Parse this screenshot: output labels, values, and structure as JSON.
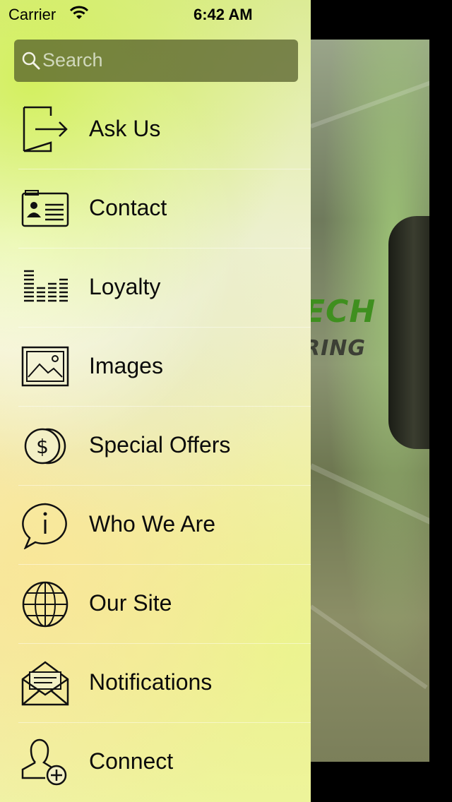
{
  "status_bar": {
    "carrier": "Carrier",
    "time": "6:42 AM",
    "wifi_icon": "wifi-icon"
  },
  "search": {
    "placeholder": "Search",
    "icon": "search-icon"
  },
  "menu": {
    "items": [
      {
        "label": "Ask Us",
        "icon": "sign-in-icon"
      },
      {
        "label": "Contact",
        "icon": "contact-card-icon"
      },
      {
        "label": "Loyalty",
        "icon": "loyalty-bars-icon"
      },
      {
        "label": "Images",
        "icon": "image-icon"
      },
      {
        "label": "Special Offers",
        "icon": "coins-icon"
      },
      {
        "label": "Who We Are",
        "icon": "info-bubble-icon"
      },
      {
        "label": "Our Site",
        "icon": "globe-icon"
      },
      {
        "label": "Notifications",
        "icon": "envelope-icon"
      },
      {
        "label": "Connect",
        "icon": "add-user-icon"
      }
    ]
  },
  "background": {
    "logo_line1": "ECH",
    "logo_line2": "RING"
  }
}
